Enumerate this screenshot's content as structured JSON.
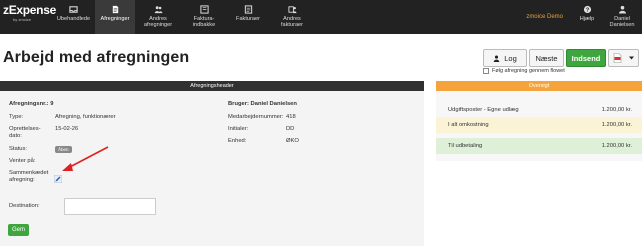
{
  "brand": {
    "logo": "zExpense",
    "by": "by zmoice"
  },
  "nav": [
    {
      "label": "Ubehandlede",
      "icon": "inbox-icon"
    },
    {
      "label": "Afregninger",
      "icon": "document-icon"
    },
    {
      "label": "Andres afregninger",
      "icon": "people-icon"
    },
    {
      "label": "Faktura-indbakke",
      "icon": "inbox-tray-icon"
    },
    {
      "label": "Fakturaer",
      "icon": "invoice-icon"
    },
    {
      "label": "Andres fakturaer",
      "icon": "people-invoice-icon"
    }
  ],
  "topright": {
    "company": "zmoice Demo",
    "help": "Hjælp",
    "user": "Daniel Danielsen"
  },
  "page": {
    "title": "Arbejd med afregningen",
    "buttons": {
      "log": "Log",
      "next": "Næste",
      "submit": "Indsend"
    },
    "follow_label": "Følg afregning gennem flowet"
  },
  "settlement_panel": {
    "header": "Afregningsheader",
    "fields": {
      "number_label": "Afregningsnr.: 9",
      "type_label": "Type:",
      "type_value": "Afregning, funktionærer",
      "created_label": "Oprettelses-dato:",
      "created_value": "15-02-26",
      "status_label": "Status:",
      "status_value": "Åben",
      "waiting_label": "Venter på:",
      "combined_label": "Sammenkædet afregning:",
      "destination_label": "Destination:"
    },
    "user": {
      "user_label": "Bruger: Daniel Danielsen",
      "employee_no_label": "Medarbejdernummer:",
      "employee_no_value": "418",
      "initials_label": "Initialer:",
      "initials_value": "DD",
      "unit_label": "Enhed:",
      "unit_value": "ØKO"
    },
    "save_button": "Gem"
  },
  "overview_panel": {
    "header": "Oversigt",
    "rows": [
      {
        "label": "Udgiftsposter - Egne udlæg",
        "value": "1.200,00 kr."
      },
      {
        "label": "I alt omkostning",
        "value": "1.200,00 kr."
      },
      {
        "label": "Til udbetaling",
        "value": "1.200,00 kr."
      }
    ]
  },
  "colors": {
    "topbar": "#222222",
    "primary_green": "#3fa63f",
    "overview_orange": "#f4a43a",
    "arrow_red": "#e02020"
  }
}
